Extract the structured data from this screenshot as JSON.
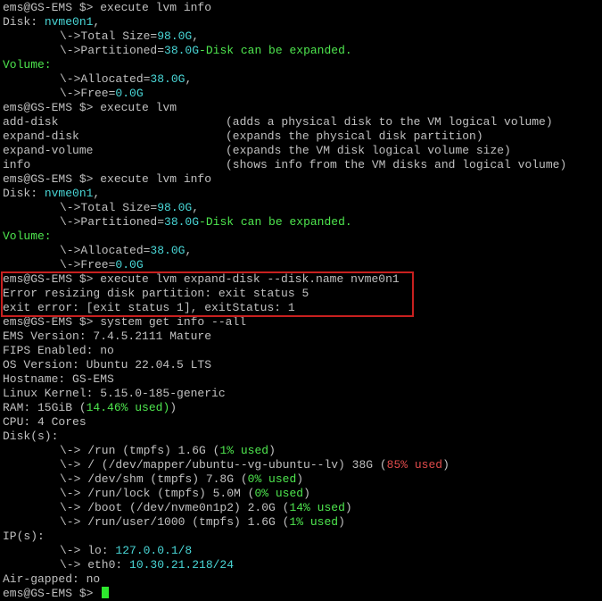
{
  "prompt": "ems@GS-EMS $> ",
  "colors": {
    "text": "#c0c0c0",
    "green": "#4ee64e",
    "cyan": "#49d6d6",
    "red": "#e04b4b",
    "box": "#c8201f",
    "cursor": "#2ee82e"
  },
  "block1": {
    "cmd": "execute lvm info",
    "disk_label": "Disk: ",
    "disk_name": "nvme0n1",
    "disk_suffix": ",",
    "total_prefix": "\\->Total Size=",
    "total_value": "98.0G",
    "total_suffix": ",",
    "part_prefix": "\\->Partitioned=",
    "part_value": "38.0G",
    "part_note": "-Disk can be expanded.",
    "volume_label": "Volume:",
    "alloc_prefix": "\\->Allocated=",
    "alloc_value": "38.0G",
    "alloc_suffix": ",",
    "free_prefix": "\\->Free=",
    "free_value": "0.0G"
  },
  "block2": {
    "cmd": "execute lvm",
    "commands": [
      {
        "name": "add-disk",
        "desc": "(adds a physical disk to the VM logical volume)"
      },
      {
        "name": "expand-disk",
        "desc": "(expands the physical disk partition)"
      },
      {
        "name": "expand-volume",
        "desc": "(expands the VM disk logical volume size)"
      },
      {
        "name": "info",
        "desc": "(shows info from the VM disks and logical volume)"
      }
    ]
  },
  "block3": {
    "cmd": "execute lvm info",
    "disk_label": "Disk: ",
    "disk_name": "nvme0n1",
    "disk_suffix": ",",
    "total_prefix": "\\->Total Size=",
    "total_value": "98.0G",
    "total_suffix": ",",
    "part_prefix": "\\->Partitioned=",
    "part_value": "38.0G",
    "part_note": "-Disk can be expanded.",
    "volume_label": "Volume:",
    "alloc_prefix": "\\->Allocated=",
    "alloc_value": "38.0G",
    "alloc_suffix": ",",
    "free_prefix": "\\->Free=",
    "free_value": "0.0G"
  },
  "block4": {
    "cmd": "execute lvm expand-disk --disk.name nvme0n1",
    "error1": "Error resizing disk partition: exit status 5",
    "error2": "exit error: [exit status 1], exitStatus: 1"
  },
  "block5": {
    "cmd": "system get info --all",
    "ems_version": "EMS Version: 7.4.5.2111 Mature",
    "fips": "FIPS Enabled: no",
    "os_version": "OS Version: Ubuntu 22.04.5 LTS",
    "hostname": "Hostname: GS-EMS",
    "kernel": "Linux Kernel: 5.15.0-185-generic",
    "ram_prefix": "RAM: 15GiB (",
    "ram_pct": "14.46%",
    "ram_used": " used)",
    "cpu": "CPU: 4 Cores",
    "disks_label": "Disk(s):",
    "disks": [
      {
        "prefix": "\\-> /run (tmpfs) 1.6G (",
        "pct": "1%",
        "color": "green"
      },
      {
        "prefix": "\\-> / (/dev/mapper/ubuntu--vg-ubuntu--lv) 38G (",
        "pct": "85%",
        "color": "red"
      },
      {
        "prefix": "\\-> /dev/shm (tmpfs) 7.8G (",
        "pct": "0%",
        "color": "green"
      },
      {
        "prefix": "\\-> /run/lock (tmpfs) 5.0M (",
        "pct": "0%",
        "color": "green"
      },
      {
        "prefix": "\\-> /boot (/dev/nvme0n1p2) 2.0G (",
        "pct": "14%",
        "color": "green"
      },
      {
        "prefix": "\\-> /run/user/1000 (tmpfs) 1.6G (",
        "pct": "1%",
        "color": "green"
      }
    ],
    "used_word": " used",
    "close_paren": ")",
    "ip_label": "IP(s):",
    "ips": [
      {
        "prefix": "\\-> lo: ",
        "addr": "127.0.0.1/8"
      },
      {
        "prefix": "\\-> eth0: ",
        "addr": "10.30.21.218/24"
      }
    ],
    "airgapped": "Air-gapped: no"
  }
}
